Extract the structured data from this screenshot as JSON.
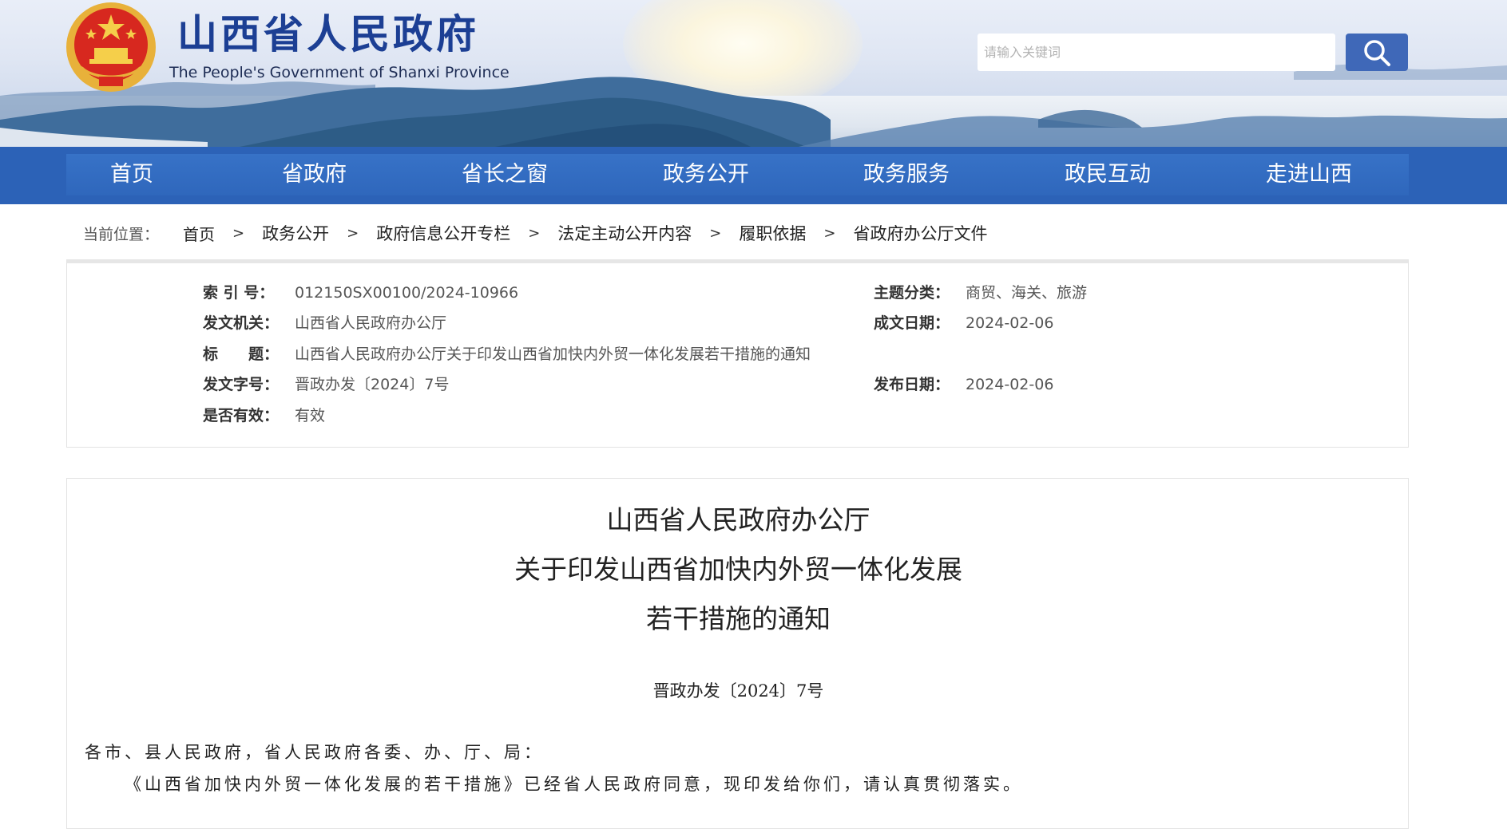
{
  "header": {
    "site_title": "山西省人民政府",
    "site_subtitle": "The People's Government of Shanxi Province",
    "search_placeholder": "请输入关键词",
    "emblem_icon": "national-emblem-icon",
    "search_icon": "magnifier-icon"
  },
  "colors": {
    "brand_blue": "#1c3f94",
    "nav_blue": "#2c62b7",
    "search_button": "#3f68b8"
  },
  "nav": {
    "items": [
      "首页",
      "省政府",
      "省长之窗",
      "政务公开",
      "政务服务",
      "政民互动",
      "走进山西"
    ]
  },
  "breadcrumb": {
    "label": "当前位置：",
    "items": [
      "首页",
      "政务公开",
      "政府信息公开专栏",
      "法定主动公开内容",
      "履职依据",
      "省政府办公厅文件"
    ],
    "separator": ">"
  },
  "info": {
    "index_label": "索 引 号：",
    "index_value": "012150SX00100/2024-10966",
    "topic_label": "主题分类：",
    "topic_value": "商贸、海关、旅游",
    "issuer_label": "发文机关：",
    "issuer_value": "山西省人民政府办公厅",
    "written_date_label": "成文日期：",
    "written_date_value": "2024-02-06",
    "title_label": "标　　题：",
    "title_value": "山西省人民政府办公厅关于印发山西省加快内外贸一体化发展若干措施的通知",
    "doc_no_label": "发文字号：",
    "doc_no_value": "晋政办发〔2024〕7号",
    "publish_date_label": "发布日期：",
    "publish_date_value": "2024-02-06",
    "validity_label": "是否有效：",
    "validity_value": "有效"
  },
  "article": {
    "title_line1": "山西省人民政府办公厅",
    "title_line2": "关于印发山西省加快内外贸一体化发展",
    "title_line3": "若干措施的通知",
    "doc_number": "晋政办发〔2024〕7号",
    "salutation": "各市、县人民政府，省人民政府各委、办、厅、局：",
    "body_para1": "《山西省加快内外贸一体化发展的若干措施》已经省人民政府同意，现印发给你们，请认真贯彻落实。"
  }
}
